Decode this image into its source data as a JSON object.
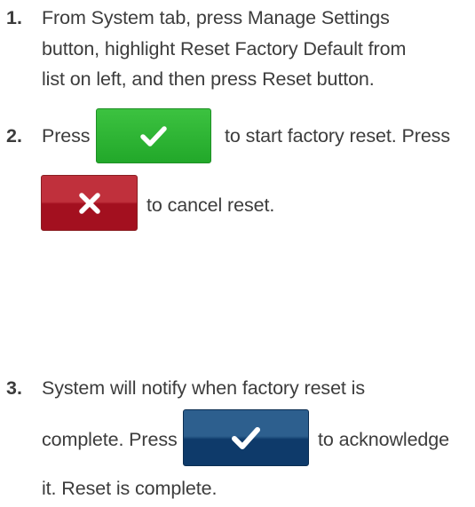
{
  "steps": [
    {
      "number": "1.",
      "lines": [
        "From System tab, press Manage Settings",
        "button, highlight Reset Factory Default from",
        "list on left, and then press Reset button."
      ]
    },
    {
      "number": "2.",
      "before_accept": "Press",
      "after_accept": "to start factory reset. Press",
      "after_cancel": "to cancel reset."
    },
    {
      "number": "3.",
      "line1": "System will notify when factory reset is",
      "before_ok": "complete. Press",
      "after_ok": "to acknowledge",
      "line3": "it. Reset is complete."
    }
  ],
  "buttons": {
    "accept": {
      "icon": "checkmark-icon",
      "color": "#2db534"
    },
    "cancel": {
      "icon": "x-icon",
      "color": "#b01e2c"
    },
    "ok": {
      "icon": "checkmark-icon",
      "color": "#1a4a7a"
    }
  }
}
